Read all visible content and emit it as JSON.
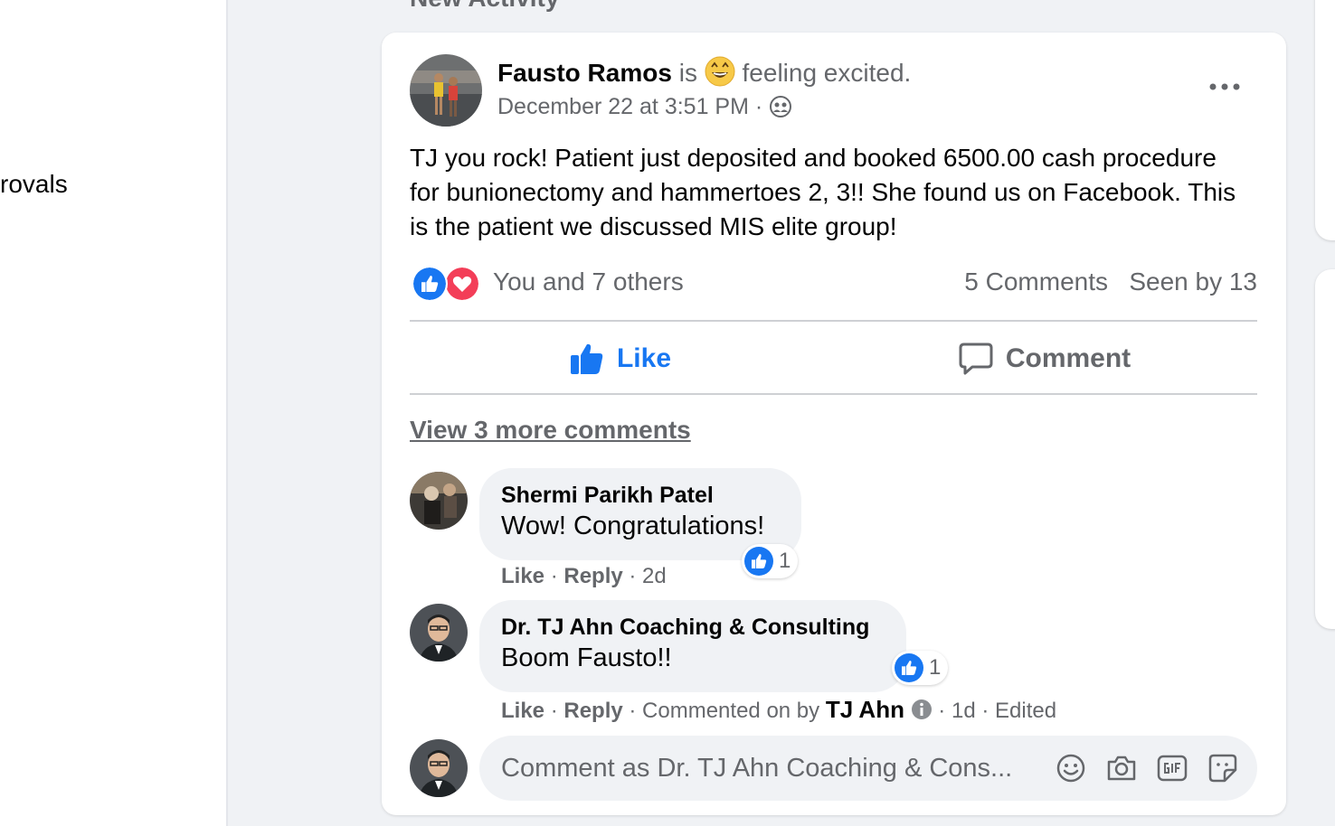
{
  "sidebar": {
    "partial_item_label": "rovals"
  },
  "feed": {
    "section_title": "New Activity"
  },
  "post": {
    "author": "Fausto Ramos",
    "verb": "is",
    "feeling": "feeling excited.",
    "timestamp": "December 22 at 3:51 PM",
    "separator": "·",
    "body": "TJ you rock! Patient just deposited and booked 6500.00 cash procedure for bunionectomy and hammertoes 2, 3!! She found us on Facebook. This is the patient we discussed MIS elite group!",
    "reaction_summary": "You and 7 others",
    "comments_count": "5 Comments",
    "seen_by": "Seen by 13",
    "actions": {
      "like": "Like",
      "comment": "Comment"
    },
    "view_more": "View 3 more comments"
  },
  "comments": [
    {
      "author": "Shermi Parikh Patel",
      "text": "Wow! Congratulations!",
      "reaction_count": "1",
      "like": "Like",
      "reply": "Reply",
      "time": "2d"
    },
    {
      "author": "Dr. TJ Ahn Coaching & Consulting",
      "text": "Boom Fausto!!",
      "reaction_count": "1",
      "like": "Like",
      "reply": "Reply",
      "commented_on_by": "Commented on by",
      "commented_by_name": "TJ Ahn",
      "time": "1d",
      "edited": "Edited"
    }
  ],
  "composer": {
    "placeholder": "Comment as Dr. TJ Ahn Coaching & Cons...",
    "icons": [
      "emoji-icon",
      "camera-icon",
      "gif-icon",
      "sticker-icon"
    ]
  },
  "colors": {
    "accent": "#1877f2",
    "love": "#f33e58",
    "muted": "#65676b",
    "bubble": "#f0f2f5"
  }
}
